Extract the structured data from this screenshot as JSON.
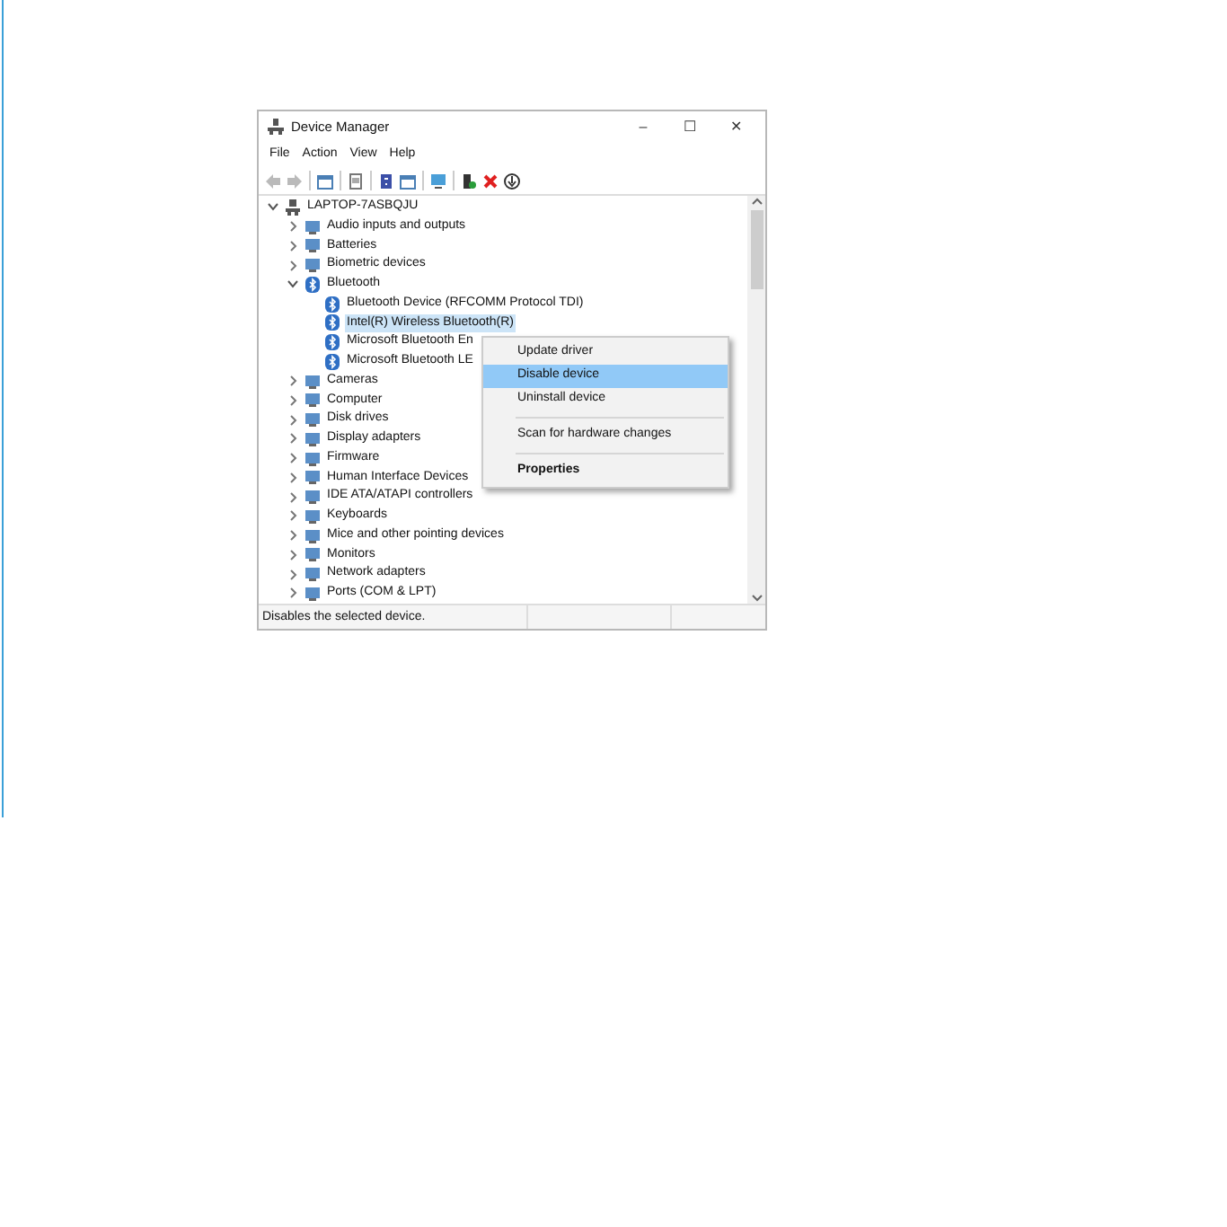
{
  "window": {
    "title": "Device Manager",
    "controls": [
      "–",
      "☐",
      "✕"
    ]
  },
  "menu": [
    "File",
    "Action",
    "View",
    "Help"
  ],
  "toolbar": [
    {
      "kind": "back",
      "disabled": true
    },
    {
      "kind": "forward",
      "disabled": true
    },
    {
      "kind": "sep"
    },
    {
      "kind": "view"
    },
    {
      "kind": "sep"
    },
    {
      "kind": "page"
    },
    {
      "kind": "sep"
    },
    {
      "kind": "help"
    },
    {
      "kind": "view"
    },
    {
      "kind": "sep"
    },
    {
      "kind": "monitor"
    },
    {
      "kind": "sep"
    },
    {
      "kind": "add"
    },
    {
      "kind": "remove"
    },
    {
      "kind": "download"
    }
  ],
  "tree": {
    "label": "LAPTOP-7ASBQJU",
    "kind": "computer",
    "expanded": true,
    "children": [
      {
        "label": "Audio inputs and outputs",
        "kind": "device",
        "expanded": false,
        "selected": false
      },
      {
        "label": "Batteries",
        "kind": "device",
        "expanded": false,
        "selected": false
      },
      {
        "label": "Biometric devices",
        "kind": "device",
        "expanded": false,
        "selected": false
      },
      {
        "label": "Bluetooth",
        "kind": "bluetooth",
        "expanded": true,
        "selected": false,
        "children": [
          {
            "label": "Bluetooth Device (RFCOMM Protocol TDI)",
            "kind": "bluetooth",
            "selected": false
          },
          {
            "label": "Intel(R) Wireless Bluetooth(R)",
            "kind": "bluetooth",
            "selected": true
          },
          {
            "label": "Microsoft Bluetooth En",
            "kind": "bluetooth",
            "selected": false
          },
          {
            "label": "Microsoft Bluetooth LE",
            "kind": "bluetooth",
            "selected": false
          }
        ]
      },
      {
        "label": "Cameras",
        "kind": "device",
        "expanded": false,
        "selected": false
      },
      {
        "label": "Computer",
        "kind": "device",
        "expanded": false,
        "selected": false
      },
      {
        "label": "Disk drives",
        "kind": "device",
        "expanded": false,
        "selected": false
      },
      {
        "label": "Display adapters",
        "kind": "device",
        "expanded": false,
        "selected": false
      },
      {
        "label": "Firmware",
        "kind": "device",
        "expanded": false,
        "selected": false
      },
      {
        "label": "Human Interface Devices",
        "kind": "device",
        "expanded": false,
        "selected": false
      },
      {
        "label": "IDE ATA/ATAPI controllers",
        "kind": "device",
        "expanded": false,
        "selected": false
      },
      {
        "label": "Keyboards",
        "kind": "device",
        "expanded": false,
        "selected": false
      },
      {
        "label": "Mice and other pointing devices",
        "kind": "device",
        "expanded": false,
        "selected": false
      },
      {
        "label": "Monitors",
        "kind": "device",
        "expanded": false,
        "selected": false
      },
      {
        "label": "Network adapters",
        "kind": "device",
        "expanded": false,
        "selected": false
      },
      {
        "label": "Ports (COM & LPT)",
        "kind": "device",
        "expanded": false,
        "selected": false
      }
    ]
  },
  "context_menu": [
    {
      "label": "Update driver",
      "selected": false,
      "separator_before": false,
      "bold": false
    },
    {
      "label": "Disable device",
      "selected": true,
      "separator_before": false,
      "bold": false
    },
    {
      "label": "Uninstall device",
      "selected": false,
      "separator_before": false,
      "bold": false
    },
    {
      "label": "Scan for hardware changes",
      "selected": false,
      "separator_before": true,
      "bold": false
    },
    {
      "label": "Properties",
      "selected": false,
      "separator_before": true,
      "bold": true
    }
  ],
  "status_bar": "Disables the selected device."
}
